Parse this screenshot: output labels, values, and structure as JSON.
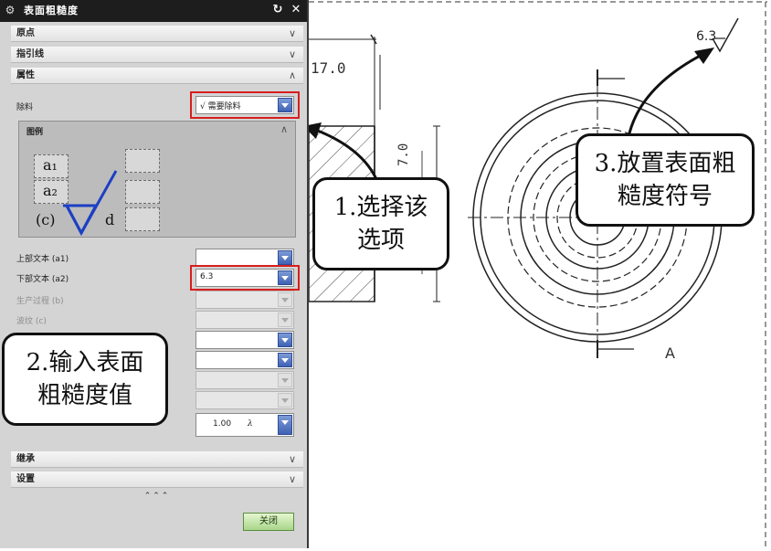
{
  "dialog": {
    "title": "表面粗糙度",
    "sections": {
      "origin": "原点",
      "leader": "指引线",
      "attributes": "属性",
      "inherit": "继承",
      "settings": "设置"
    },
    "material_label": "除料",
    "material_value": "√ 需要除料",
    "legend_title": "图例",
    "legend_symbols": {
      "a1": "a₁",
      "a2": "a₂",
      "c": "(c)",
      "d": "d"
    },
    "fields": {
      "upper_text": {
        "label": "上部文本 (a1)",
        "value": ""
      },
      "lower_text": {
        "label": "下部文本 (a2)",
        "value": "6.3"
      },
      "production_process": {
        "label": "生产过程 (b)",
        "value": ""
      },
      "waviness": {
        "label": "波纹 (c)",
        "value": ""
      }
    },
    "cutoff_value": "1.00",
    "cutoff_unit": "λ",
    "expand_glyph": "⌃⌃⌃",
    "ok_label": "关闭"
  },
  "drawing": {
    "dimension_left": "17.0",
    "dimension_vertical": "7.0",
    "roughness_symbol": "6.3",
    "section_label": "A"
  },
  "callouts": {
    "c1": [
      "1.选择该",
      "选项"
    ],
    "c2": [
      "2.输入表面",
      "粗糙度值"
    ],
    "c3": [
      "3.放置表面粗",
      "糙度符号"
    ]
  }
}
